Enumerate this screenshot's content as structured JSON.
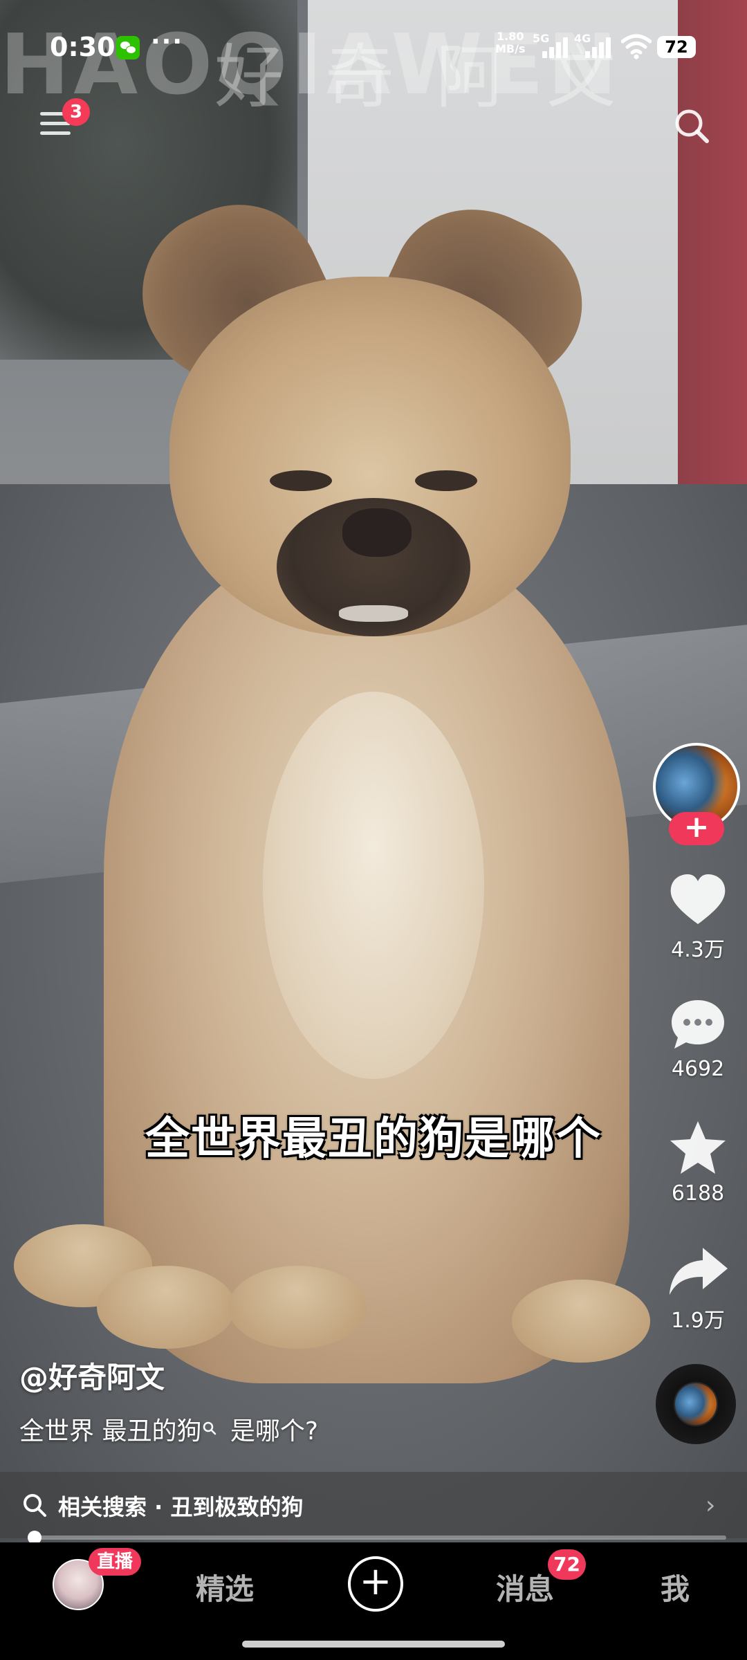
{
  "status_bar": {
    "time": "0:30",
    "net_speed_value": "1.80",
    "net_speed_unit": "MB/s",
    "network_1": "5G",
    "network_2": "4G",
    "battery": "72",
    "more": "···"
  },
  "video": {
    "watermark_cn": "好奇阿文",
    "watermark_en": "HAOQIAWEN",
    "subtitle": "全世界最丑的狗是哪个"
  },
  "top": {
    "menu_badge": "3"
  },
  "rail": {
    "follow": "+",
    "likes": "4.3万",
    "comments": "4692",
    "favorites": "6188",
    "shares": "1.9万"
  },
  "post": {
    "author": "@好奇阿文",
    "description_part1": "全世界 最丑的狗",
    "description_part2": " 是哪个?"
  },
  "related_search": {
    "label": "相关搜索 · 丑到极致的狗",
    "chevron": "›"
  },
  "progress": {
    "fraction": 0.01
  },
  "bottom_nav": {
    "live_badge": "直播",
    "tab_featured": "精选",
    "plus": "+",
    "tab_messages": "消息",
    "messages_badge": "72",
    "tab_me": "我"
  },
  "colors": {
    "accent": "#f0385b"
  }
}
